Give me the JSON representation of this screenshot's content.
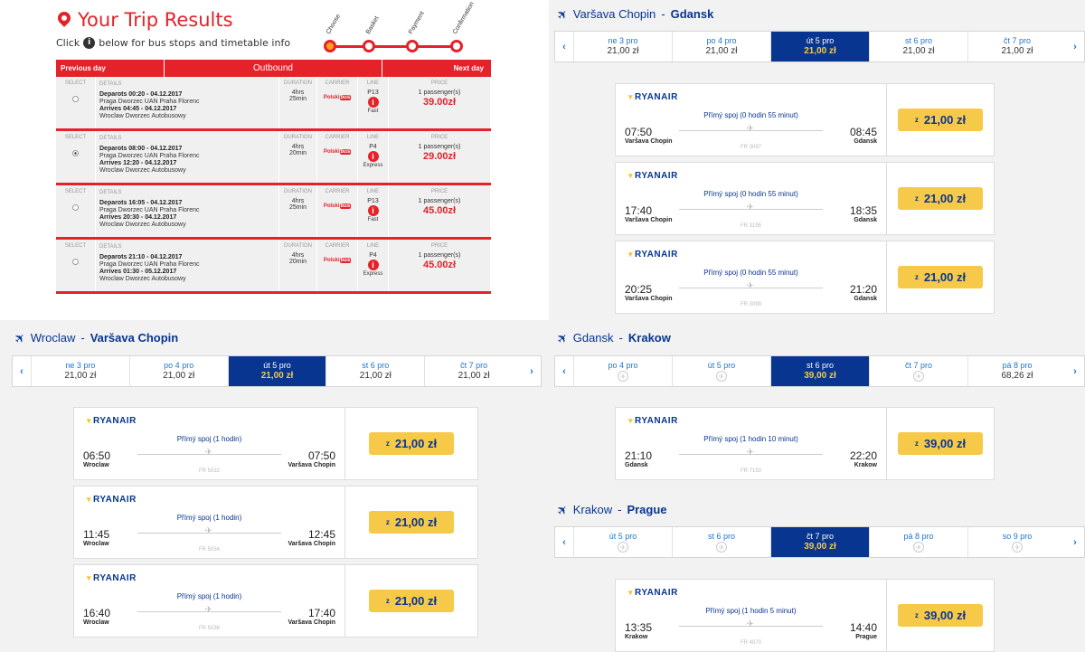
{
  "bus": {
    "title": "Your Trip Results",
    "subtitle_before": "Click",
    "subtitle_after": "below for bus stops and timetable info",
    "steps": [
      "Choose",
      "Basket",
      "Payment",
      "Confirmation"
    ],
    "header": {
      "prev": "Previous day",
      "outbound": "Outbound",
      "next": "Next day"
    },
    "col_labels": {
      "select": "SELECT",
      "details": "DETAILS",
      "duration": "DURATION",
      "carrier": "CARRIER",
      "line": "LINE",
      "price": "PRICE"
    },
    "rows": [
      {
        "departs": "Deparots 00:20 - 04.12.2017",
        "from": "Praga Dworzec UAN Praha Florenc",
        "arrives": "Arrives 04:45 - 04.12.2017",
        "to": "Wroclaw Dworzec Autobusowy",
        "dur1": "4hrs",
        "dur2": "25min",
        "line": "P13",
        "line_type": "Fast",
        "pax": "1 passenger(s)",
        "price": "39.00zł",
        "selected": false
      },
      {
        "departs": "Deparots 08:00 - 04.12.2017",
        "from": "Praga Dworzec UAN Praha Florenc",
        "arrives": "Arrives 12:20 - 04.12.2017",
        "to": "Wroclaw Dworzec Autobusowy",
        "dur1": "4hrs",
        "dur2": "20min",
        "line": "P4",
        "line_type": "Express",
        "pax": "1 passenger(s)",
        "price": "29.00zł",
        "selected": true
      },
      {
        "departs": "Deparots 16:05 - 04.12.2017",
        "from": "Praga Dworzec UAN Praha Florenc",
        "arrives": "Arrives 20:30 - 04.12.2017",
        "to": "Wroclaw Dworzec Autobusowy",
        "dur1": "4hrs",
        "dur2": "25min",
        "line": "P13",
        "line_type": "Fast",
        "pax": "1 passenger(s)",
        "price": "45.00zł",
        "selected": false
      },
      {
        "departs": "Deparots 21:10 - 04.12.2017",
        "from": "Praga Dworzec UAN Praha Florenc",
        "arrives": "Arrives 01:30 - 05.12.2017",
        "to": "Wroclaw Dworzec Autobusowy",
        "dur1": "4hrs",
        "dur2": "20min",
        "line": "P4",
        "line_type": "Express",
        "pax": "1 passenger(s)",
        "price": "45.00zł",
        "selected": false
      }
    ],
    "carrier_text": "Polski",
    "carrier_mark": "bus"
  },
  "routes": {
    "r1": {
      "from": "Varšava Chopin",
      "to": "Gdansk",
      "days": [
        {
          "d": "ne 3 pro",
          "p": "21,00 zł"
        },
        {
          "d": "po 4 pro",
          "p": "21,00 zł"
        },
        {
          "d": "út 5 pro",
          "p": "21,00 zł"
        },
        {
          "d": "st 6 pro",
          "p": "21,00 zł"
        },
        {
          "d": "čt 7 pro",
          "p": "21,00 zł"
        }
      ],
      "flights": [
        {
          "title": "Přímý spoj (0 hodin 55 minut)",
          "dep": "07:50",
          "arr": "08:45",
          "fc": "Varšava Chopin",
          "tc": "Gdansk",
          "fn": "FR 3097",
          "price": "21,00 zł"
        },
        {
          "title": "Přímý spoj (0 hodin 55 minut)",
          "dep": "17:40",
          "arr": "18:35",
          "fc": "Varšava Chopin",
          "tc": "Gdansk",
          "fn": "FR 3195",
          "price": "21,00 zł"
        },
        {
          "title": "Přímý spoj (0 hodin 55 minut)",
          "dep": "20:25",
          "arr": "21:20",
          "fc": "Varšava Chopin",
          "tc": "Gdansk",
          "fn": "FR 3099",
          "price": "21,00 zł"
        }
      ]
    },
    "r2": {
      "from": "Wroclaw",
      "to": "Varšava Chopin",
      "days": [
        {
          "d": "ne 3 pro",
          "p": "21,00 zł"
        },
        {
          "d": "po 4 pro",
          "p": "21,00 zł"
        },
        {
          "d": "út 5 pro",
          "p": "21,00 zł"
        },
        {
          "d": "st 6 pro",
          "p": "21,00 zł"
        },
        {
          "d": "čt 7 pro",
          "p": "21,00 zł"
        }
      ],
      "flights": [
        {
          "title": "Přímý spoj (1 hodin)",
          "dep": "06:50",
          "arr": "07:50",
          "fc": "Wroclaw",
          "tc": "Varšava Chopin",
          "fn": "FR 5032",
          "price": "21,00 zł"
        },
        {
          "title": "Přímý spoj (1 hodin)",
          "dep": "11:45",
          "arr": "12:45",
          "fc": "Wroclaw",
          "tc": "Varšava Chopin",
          "fn": "FR 5034",
          "price": "21,00 zł"
        },
        {
          "title": "Přímý spoj (1 hodin)",
          "dep": "16:40",
          "arr": "17:40",
          "fc": "Wroclaw",
          "tc": "Varšava Chopin",
          "fn": "FR 5036",
          "price": "21,00 zł"
        }
      ]
    },
    "r3": {
      "from": "Gdansk",
      "to": "Krakow",
      "days": [
        {
          "d": "po 4 pro",
          "p": ""
        },
        {
          "d": "út 5 pro",
          "p": ""
        },
        {
          "d": "st 6 pro",
          "p": "39,00 zł"
        },
        {
          "d": "čt 7 pro",
          "p": ""
        },
        {
          "d": "pá 8 pro",
          "p": "68,26 zł"
        }
      ],
      "flights": [
        {
          "title": "Přímý spoj (1 hodin 10 minut)",
          "dep": "21:10",
          "arr": "22:20",
          "fc": "Gdansk",
          "tc": "Krakow",
          "fn": "FR 7150",
          "price": "39,00 zł"
        }
      ]
    },
    "r4": {
      "from": "Krakow",
      "to": "Prague",
      "days": [
        {
          "d": "út 5 pro",
          "p": ""
        },
        {
          "d": "st 6 pro",
          "p": ""
        },
        {
          "d": "čt 7 pro",
          "p": "39,00 zł"
        },
        {
          "d": "pá 8 pro",
          "p": ""
        },
        {
          "d": "so 9 pro",
          "p": ""
        }
      ],
      "flights": [
        {
          "title": "Přímý spoj (1 hodin 5 minut)",
          "dep": "13:35",
          "arr": "14:40",
          "fc": "Krakow",
          "tc": "Prague",
          "fn": "FR 4070",
          "price": "39,00 zł"
        }
      ]
    }
  },
  "airline": "RYANAIR",
  "price_prefix": "z",
  "colors": {
    "brand_blue": "#073590",
    "yellow": "#f7c948",
    "bus_red": "#e5212a"
  }
}
